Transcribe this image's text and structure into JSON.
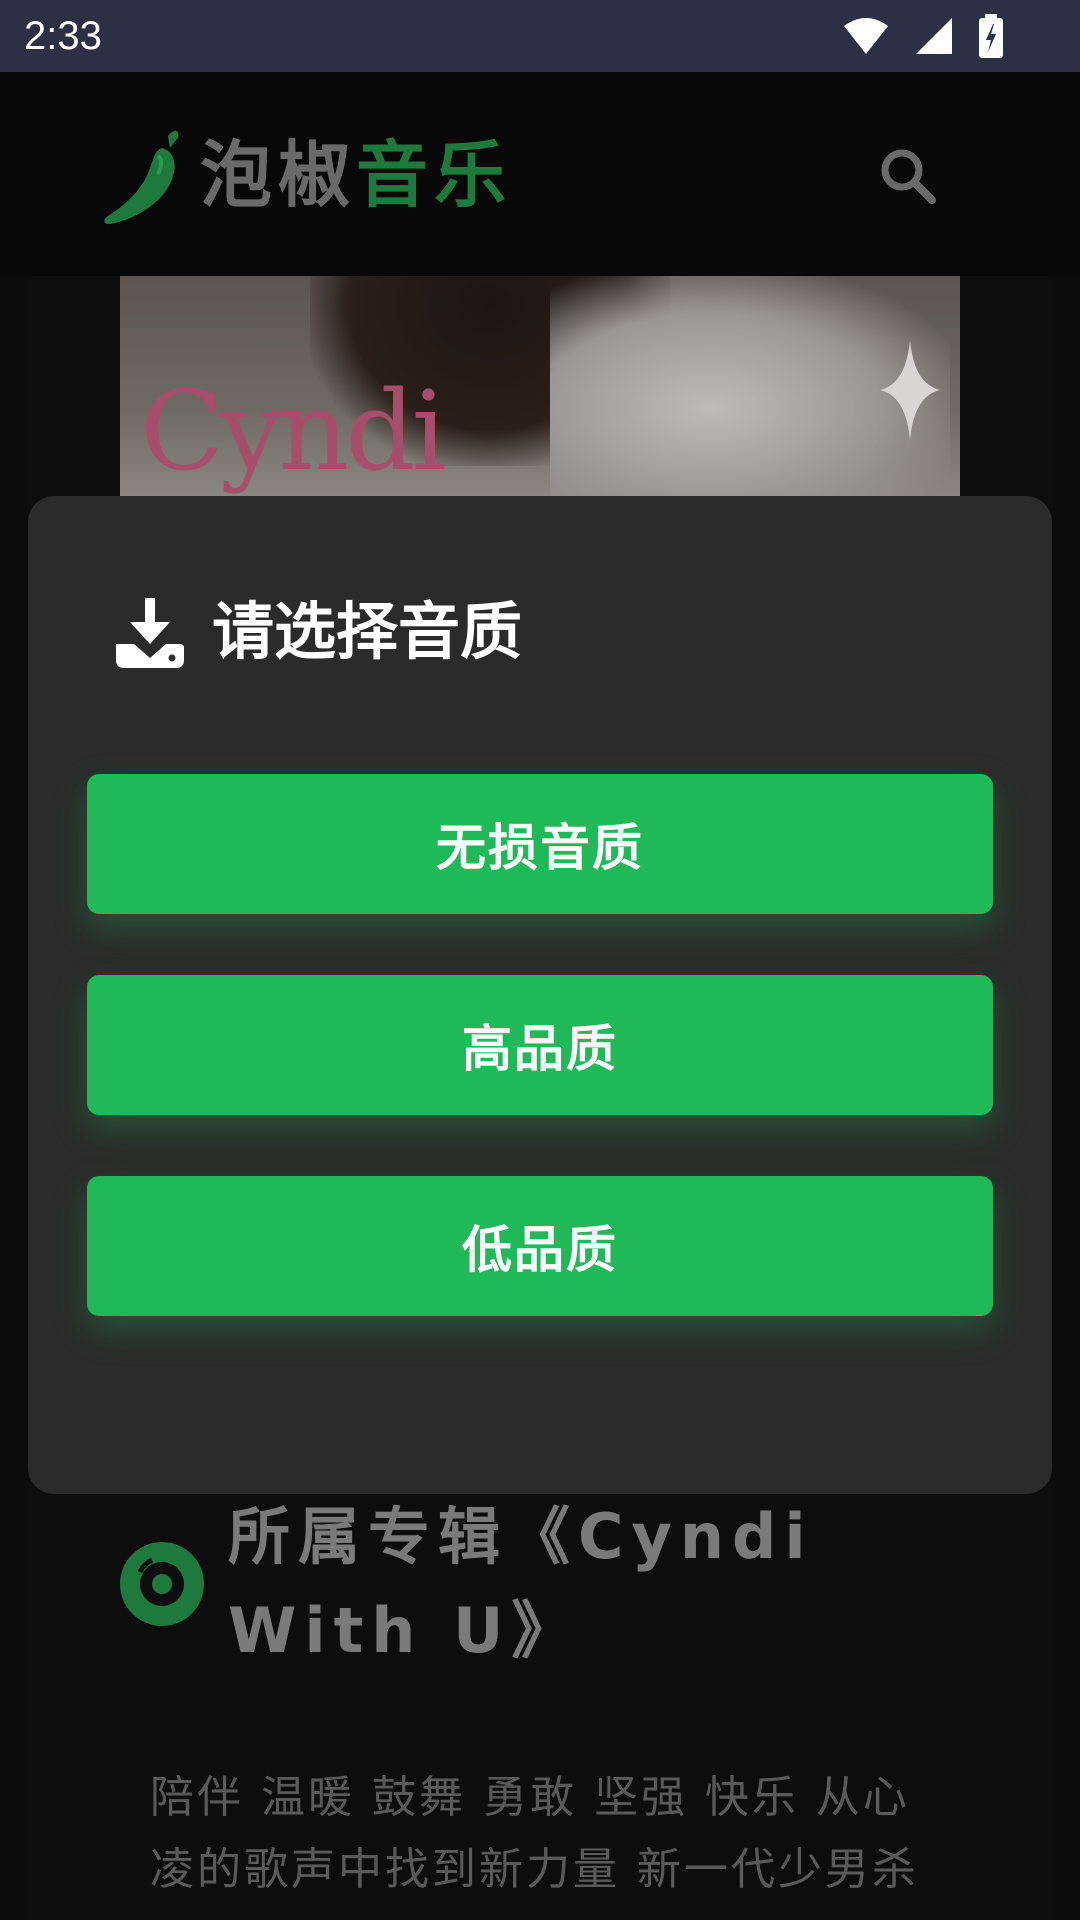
{
  "status_bar": {
    "time": "2:33",
    "icons": [
      "wifi-icon",
      "cell-signal-icon",
      "battery-charging-icon"
    ]
  },
  "header": {
    "logo_part1": "泡椒",
    "logo_part2": "音乐",
    "search_icon": "search-icon",
    "colors": {
      "brand_green": "#1e7a3c",
      "logo_gray": "#6a6a6a"
    }
  },
  "cover": {
    "title": "Cyndi"
  },
  "album": {
    "title": "所属专辑《Cyndi With U》",
    "description": "陪伴 温暖 鼓舞 勇敢 坚强 快乐 从心凌的歌声中找到新力量 新一代少男杀"
  },
  "modal": {
    "title": "请选择音质",
    "icon": "download-icon",
    "options": [
      {
        "label": "无损音质"
      },
      {
        "label": "高品质"
      },
      {
        "label": "低品质"
      }
    ],
    "colors": {
      "button": "#1fba57",
      "background": "#2b2b2b"
    }
  }
}
